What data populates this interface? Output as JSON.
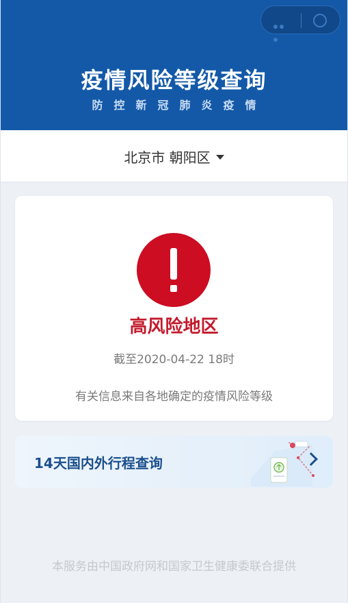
{
  "header": {
    "title": "疫情风险等级查询",
    "subtitle": "防控新冠肺炎疫情"
  },
  "location": {
    "label": "北京市 朝阳区"
  },
  "result": {
    "level": "高风险地区",
    "time": "截至2020-04-22 18时",
    "note": "有关信息来自各地确定的疫情风险等级"
  },
  "trip": {
    "label": "14天国内外行程查询"
  },
  "footer": {
    "text": "本服务由中国政府网和国家卫生健康委联合提供"
  },
  "colors": {
    "header_bg": "#1459a8",
    "alert_red": "#cc0d22",
    "risk_text": "#c31a2c",
    "trip_text": "#1a4f8c"
  }
}
